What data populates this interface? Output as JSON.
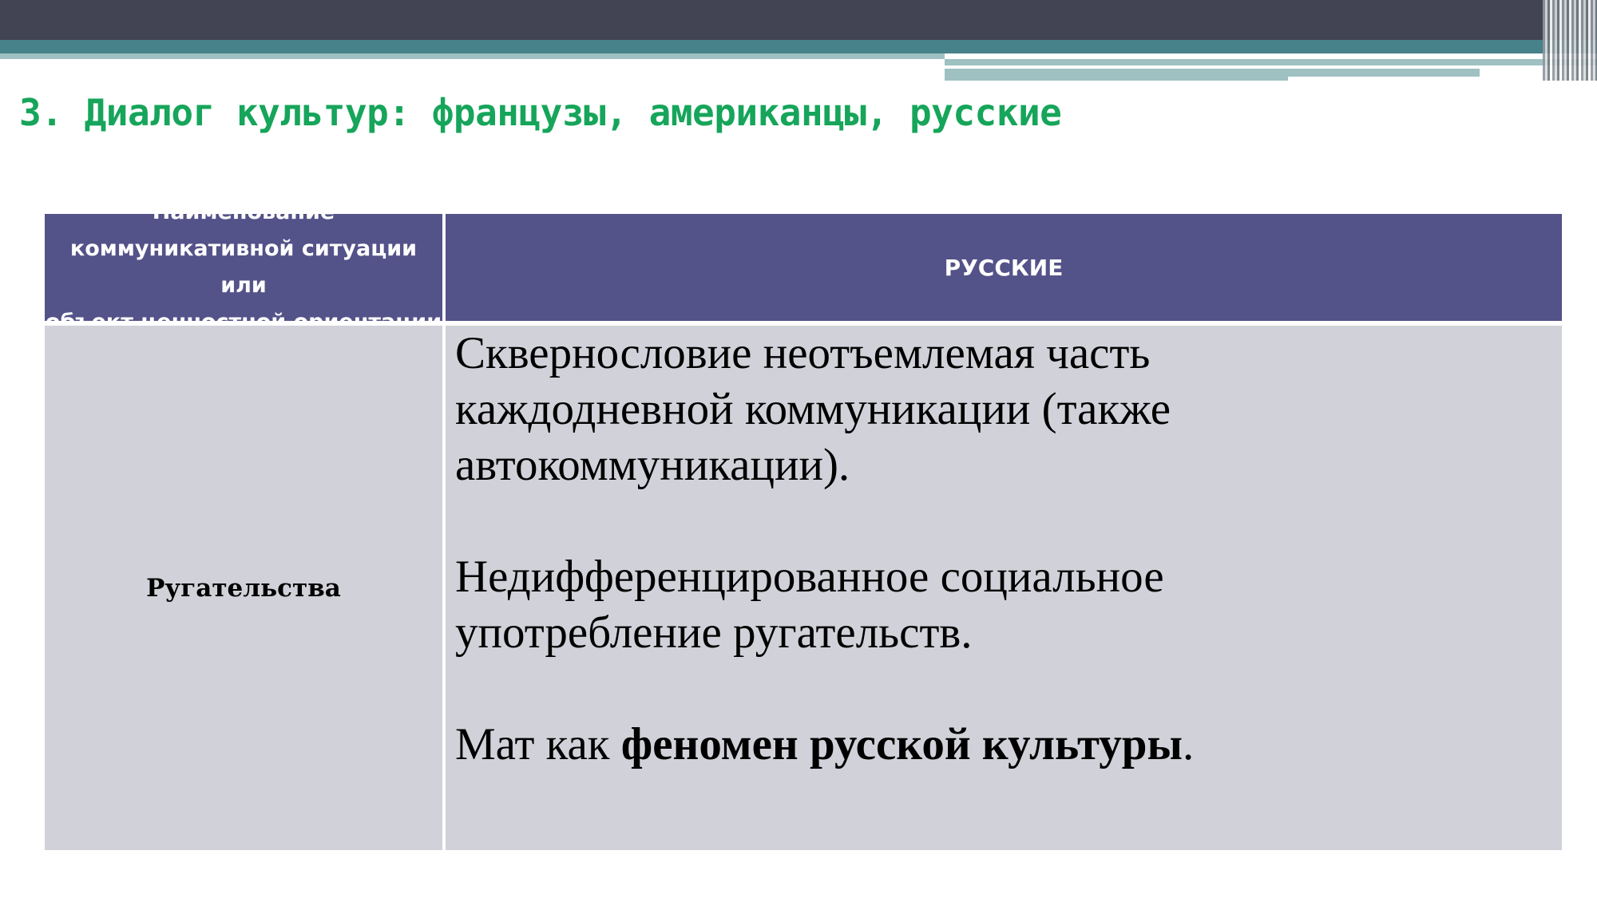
{
  "slide": {
    "title": "3. Диалог культур: французы, американцы, русские"
  },
  "table": {
    "header": {
      "left_lines": [
        "Наименование",
        "коммуникативной ситуации или",
        "объект ценностной ориентации"
      ],
      "right": "РУССКИЕ"
    },
    "row": {
      "label": "Ругательства",
      "paragraph1_lines": [
        "Сквернословие неотъемлемая часть",
        "каждодневной коммуникации (также",
        "автокоммуникации)."
      ],
      "paragraph2_lines": [
        "Недифференцированное социальное",
        "употребление ругательств."
      ],
      "paragraph3": {
        "prefix": "Мат как ",
        "bold": "феномен русской культуры",
        "suffix": "."
      }
    }
  }
}
